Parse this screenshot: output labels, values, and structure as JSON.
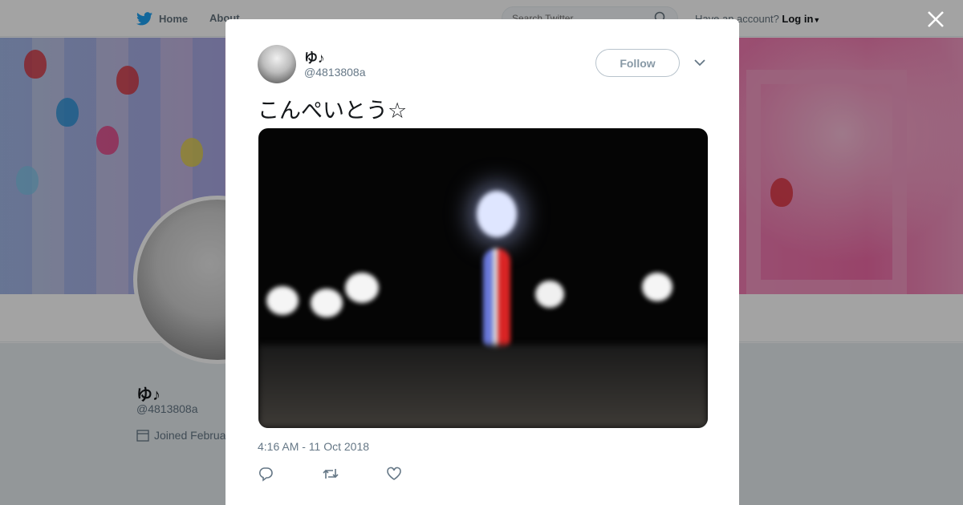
{
  "nav": {
    "home_label": "Home",
    "about_label": "About"
  },
  "search": {
    "placeholder": "Search Twitter"
  },
  "account": {
    "prompt": "Have an account?",
    "login_label": "Log in"
  },
  "profile": {
    "name": "ゆ♪",
    "handle": "@4813808a",
    "joined": "Joined Februa"
  },
  "tweet": {
    "author_name": "ゆ♪",
    "author_handle": "@4813808a",
    "follow_label": "Follow",
    "text": "こんぺいとう☆",
    "timestamp": "4:16 AM - 11 Oct 2018"
  },
  "colors": {
    "accent": "#1da1f2",
    "text": "#14171a",
    "muted": "#657786"
  },
  "icons": [
    "twitter-bird-icon",
    "search-icon",
    "caret-down-icon",
    "close-icon",
    "calendar-icon",
    "reply-icon",
    "retweet-icon",
    "like-icon",
    "chevron-down-icon"
  ]
}
